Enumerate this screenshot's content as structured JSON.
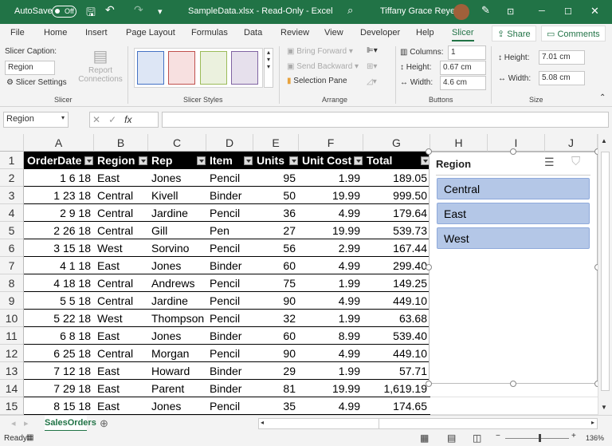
{
  "titlebar": {
    "autosave": "AutoSave",
    "autosave_state": "Off",
    "doc_title": "SampleData.xlsx  -  Read-Only  -  Excel",
    "user": "Tiffany Grace Reyes"
  },
  "tabs": [
    "File",
    "Home",
    "Insert",
    "Page Layout",
    "Formulas",
    "Data",
    "Review",
    "View",
    "Developer",
    "Help",
    "Slicer"
  ],
  "share": "Share",
  "comments": "Comments",
  "ribbon": {
    "slicer_caption_label": "Slicer Caption:",
    "slicer_caption_value": "Region",
    "slicer_settings": "Slicer Settings",
    "report_connections": "Report Connections",
    "group_slicer": "Slicer",
    "group_styles": "Slicer Styles",
    "bring_forward": "Bring Forward",
    "send_backward": "Send Backward",
    "selection_pane": "Selection Pane",
    "group_arrange": "Arrange",
    "columns_label": "Columns:",
    "columns_value": "1",
    "height_label": "Height:",
    "height_value": "0.67 cm",
    "width_label": "Width:",
    "width_value": "4.6 cm",
    "group_buttons": "Buttons",
    "size_height_label": "Height:",
    "size_height_value": "7.01 cm",
    "size_width_label": "Width:",
    "size_width_value": "5.08 cm",
    "group_size": "Size"
  },
  "formula_bar": {
    "name_box": "Region",
    "fx": "fx",
    "value": ""
  },
  "columns": [
    "A",
    "B",
    "C",
    "D",
    "E",
    "F",
    "G",
    "H",
    "I",
    "J"
  ],
  "table": {
    "headers": [
      "OrderDate",
      "Region",
      "Rep",
      "Item",
      "Units",
      "Unit Cost",
      "Total"
    ],
    "rows": [
      [
        "1 6 18",
        "East",
        "Jones",
        "Pencil",
        "95",
        "1.99",
        "189.05"
      ],
      [
        "1 23 18",
        "Central",
        "Kivell",
        "Binder",
        "50",
        "19.99",
        "999.50"
      ],
      [
        "2 9 18",
        "Central",
        "Jardine",
        "Pencil",
        "36",
        "4.99",
        "179.64"
      ],
      [
        "2 26 18",
        "Central",
        "Gill",
        "Pen",
        "27",
        "19.99",
        "539.73"
      ],
      [
        "3 15 18",
        "West",
        "Sorvino",
        "Pencil",
        "56",
        "2.99",
        "167.44"
      ],
      [
        "4 1 18",
        "East",
        "Jones",
        "Binder",
        "60",
        "4.99",
        "299.40"
      ],
      [
        "4 18 18",
        "Central",
        "Andrews",
        "Pencil",
        "75",
        "1.99",
        "149.25"
      ],
      [
        "5 5 18",
        "Central",
        "Jardine",
        "Pencil",
        "90",
        "4.99",
        "449.10"
      ],
      [
        "5 22 18",
        "West",
        "Thompson",
        "Pencil",
        "32",
        "1.99",
        "63.68"
      ],
      [
        "6 8 18",
        "East",
        "Jones",
        "Binder",
        "60",
        "8.99",
        "539.40"
      ],
      [
        "6 25 18",
        "Central",
        "Morgan",
        "Pencil",
        "90",
        "4.99",
        "449.10"
      ],
      [
        "7 12 18",
        "East",
        "Howard",
        "Binder",
        "29",
        "1.99",
        "57.71"
      ],
      [
        "7 29 18",
        "East",
        "Parent",
        "Binder",
        "81",
        "19.99",
        "1,619.19"
      ],
      [
        "8 15 18",
        "East",
        "Jones",
        "Pencil",
        "35",
        "4.99",
        "174.65"
      ]
    ]
  },
  "row_numbers": [
    "1",
    "2",
    "3",
    "4",
    "5",
    "6",
    "7",
    "8",
    "9",
    "10",
    "11",
    "12",
    "13",
    "14",
    "15"
  ],
  "slicer": {
    "title": "Region",
    "items": [
      "Central",
      "East",
      "West"
    ]
  },
  "sheet_tab": "SalesOrders",
  "status": {
    "ready": "Ready",
    "zoom": "136%"
  },
  "colors": {
    "excel_green": "#217346",
    "slicer_item": "#b4c7e7"
  }
}
